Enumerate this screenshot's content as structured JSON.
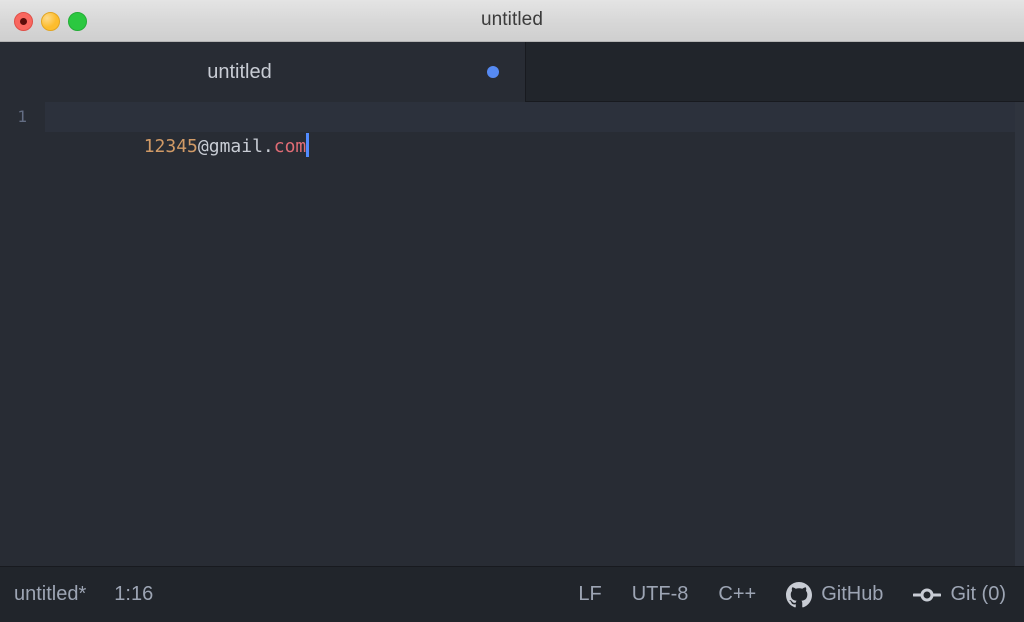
{
  "window": {
    "title": "untitled",
    "traffic_lights": [
      {
        "name": "close",
        "color": "#f9675f"
      },
      {
        "name": "minimize",
        "color": "#fdbd2e"
      },
      {
        "name": "zoom",
        "color": "#2bc840"
      }
    ]
  },
  "tabs": [
    {
      "label": "untitled",
      "modified": true,
      "modified_color": "#568af2",
      "active": true
    }
  ],
  "editor": {
    "lines": [
      {
        "number": "1",
        "active": true,
        "tokens": [
          {
            "text": "12345",
            "kind": "number",
            "color": "#d19a66"
          },
          {
            "text": "@gmail.",
            "kind": "plain",
            "color": "#c8ccd4"
          },
          {
            "text": "com",
            "kind": "keyword",
            "color": "#e06c75"
          }
        ]
      }
    ],
    "cursor_color": "#528bff",
    "background": "#282c34",
    "active_line_background": "#2c313c"
  },
  "statusbar": {
    "file_name": "untitled*",
    "cursor_position": "1:16",
    "line_ending": "LF",
    "encoding": "UTF-8",
    "grammar": "C++",
    "github_label": "GitHub",
    "git_label": "Git (0)",
    "github_icon": "github-octocat-icon",
    "git_icon": "git-commit-icon"
  }
}
